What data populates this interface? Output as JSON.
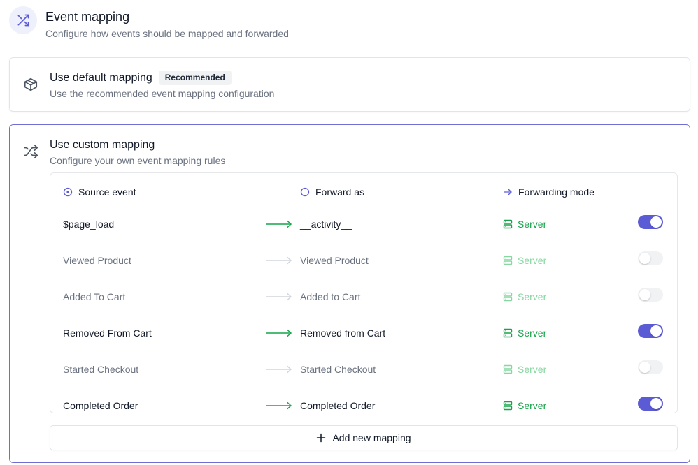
{
  "header": {
    "icon": "shuffle-icon",
    "title": "Event mapping",
    "subtitle": "Configure how events should be mapped and forwarded"
  },
  "default_mapping": {
    "icon": "package-icon",
    "title": "Use default mapping",
    "badge": "Recommended",
    "subtitle": "Use the recommended event mapping configuration"
  },
  "custom_mapping": {
    "icon": "shuffle-icon",
    "title": "Use custom mapping",
    "subtitle": "Configure your own event mapping rules",
    "columns": {
      "source": "Source event",
      "forward": "Forward as",
      "mode": "Forwarding mode"
    },
    "rows": [
      {
        "source": "$page_load",
        "forward": "__activity__",
        "mode": "Server",
        "enabled": true
      },
      {
        "source": "Viewed Product",
        "forward": "Viewed Product",
        "mode": "Server",
        "enabled": false
      },
      {
        "source": "Added To Cart",
        "forward": "Added to Cart",
        "mode": "Server",
        "enabled": false
      },
      {
        "source": "Removed From Cart",
        "forward": "Removed from Cart",
        "mode": "Server",
        "enabled": true
      },
      {
        "source": "Started Checkout",
        "forward": "Started Checkout",
        "mode": "Server",
        "enabled": false
      },
      {
        "source": "Completed Order",
        "forward": "Completed Order",
        "mode": "Server",
        "enabled": true
      }
    ],
    "add_button": "Add new mapping"
  },
  "colors": {
    "accent": "#5b5bd6",
    "success": "#16a34a",
    "border_selected": "#6e6ed4"
  }
}
